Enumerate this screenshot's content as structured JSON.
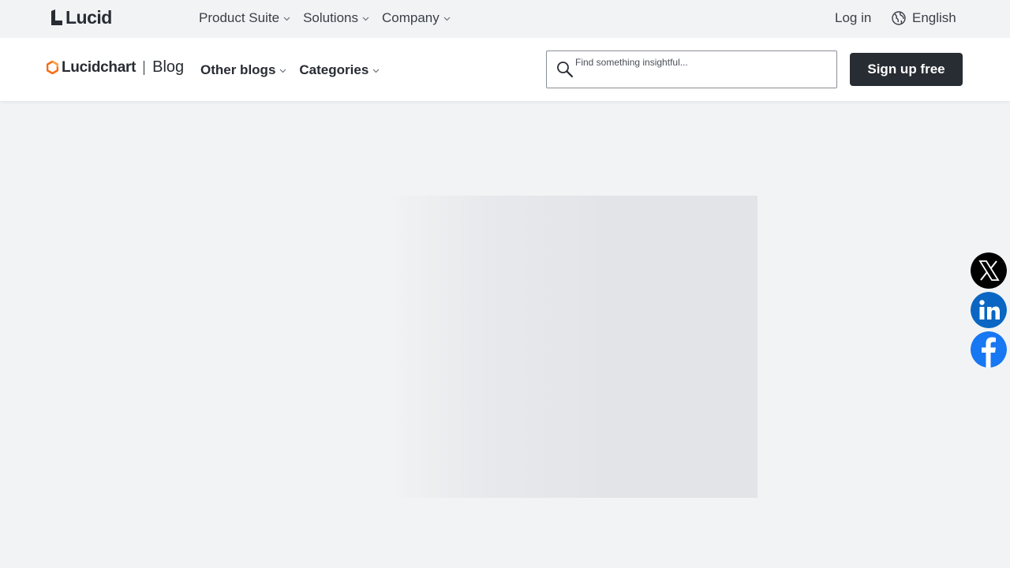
{
  "topbar": {
    "brand": "Lucid",
    "nav": [
      {
        "label": "Product Suite"
      },
      {
        "label": "Solutions"
      },
      {
        "label": "Company"
      }
    ],
    "login_label": "Log in",
    "language_label": "English"
  },
  "subbar": {
    "brand": "Lucidchart",
    "blog_label": "Blog",
    "nav": [
      {
        "label": "Other blogs"
      },
      {
        "label": "Categories"
      }
    ],
    "search": {
      "placeholder": "Find something insightful..."
    },
    "signup_label": "Sign up free"
  },
  "social": [
    "x-icon",
    "linkedin-icon",
    "facebook-icon"
  ],
  "colors": {
    "accent_orange": "#f96b13",
    "dark": "#282c33",
    "linkedin": "#0a66c2",
    "facebook": "#1877f2"
  }
}
